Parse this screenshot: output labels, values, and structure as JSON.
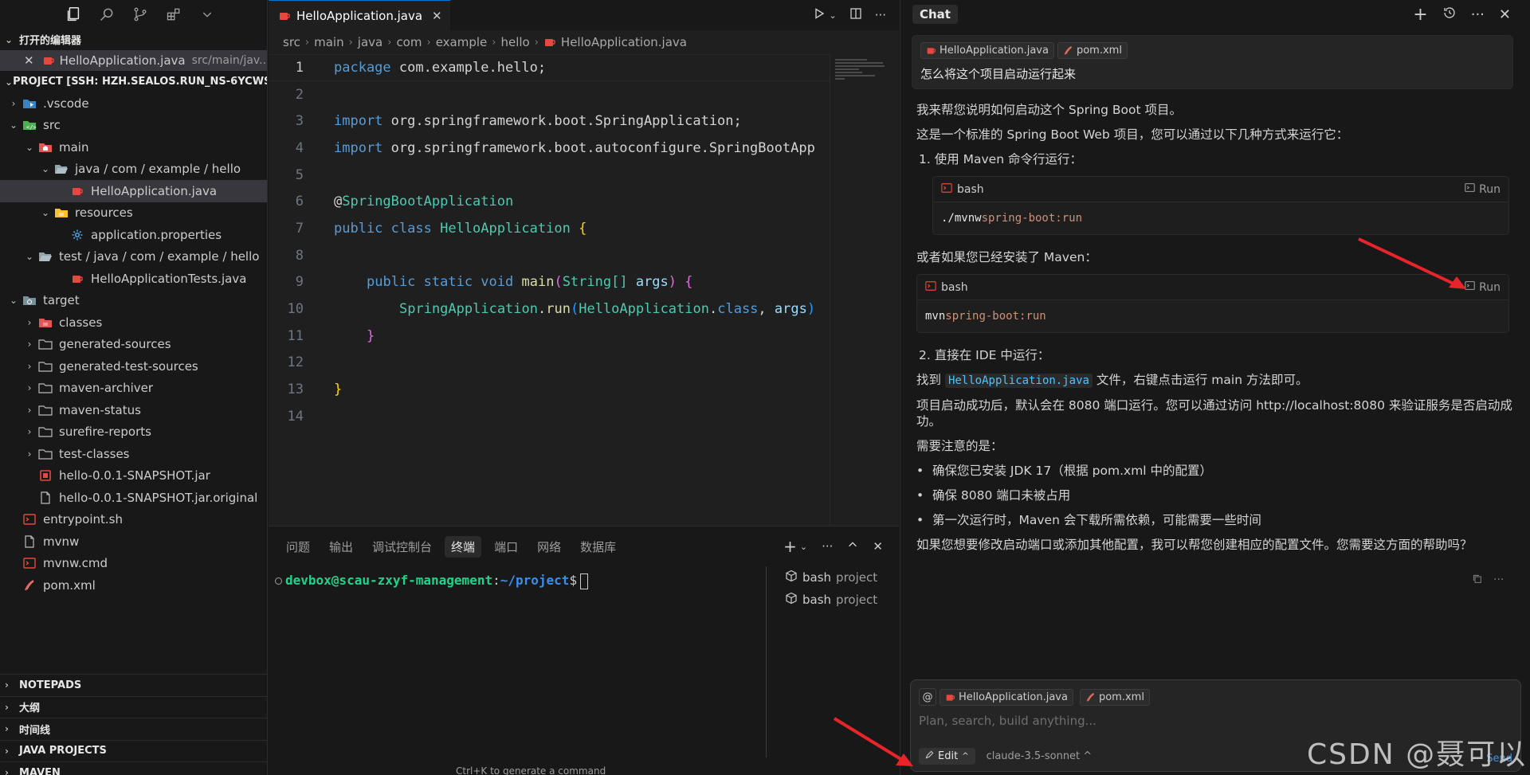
{
  "sidebar": {
    "open_editors_title": "打开的编辑器",
    "open_editor": {
      "name": "HelloApplication.java",
      "path": "src/main/jav..."
    },
    "project_title": "PROJECT [SSH: HZH.SEALOS.RUN_NS-6YCWS...",
    "tree": [
      {
        "label": ".vscode",
        "depth": 1,
        "chev": "›",
        "icon": "vscode-folder-icon"
      },
      {
        "label": "src",
        "depth": 1,
        "chev": "⌄",
        "icon": "src-folder-icon"
      },
      {
        "label": "main",
        "depth": 2,
        "chev": "⌄",
        "icon": "main-folder-icon"
      },
      {
        "label": "java / com / example / hello",
        "depth": 3,
        "chev": "⌄",
        "icon": "folder-open-icon"
      },
      {
        "label": "HelloApplication.java",
        "depth": 4,
        "chev": "",
        "icon": "java-file-icon",
        "selected": true
      },
      {
        "label": "resources",
        "depth": 3,
        "chev": "⌄",
        "icon": "resources-folder-icon"
      },
      {
        "label": "application.properties",
        "depth": 4,
        "chev": "",
        "icon": "gear-file-icon"
      },
      {
        "label": "test / java / com / example / hello",
        "depth": 2,
        "chev": "⌄",
        "icon": "folder-open-icon"
      },
      {
        "label": "HelloApplicationTests.java",
        "depth": 4,
        "chev": "",
        "icon": "java-file-icon"
      },
      {
        "label": "target",
        "depth": 1,
        "chev": "⌄",
        "icon": "target-folder-icon"
      },
      {
        "label": "classes",
        "depth": 2,
        "chev": "›",
        "icon": "classes-folder-icon"
      },
      {
        "label": "generated-sources",
        "depth": 2,
        "chev": "›",
        "icon": "folder-icon"
      },
      {
        "label": "generated-test-sources",
        "depth": 2,
        "chev": "›",
        "icon": "folder-icon"
      },
      {
        "label": "maven-archiver",
        "depth": 2,
        "chev": "›",
        "icon": "folder-icon"
      },
      {
        "label": "maven-status",
        "depth": 2,
        "chev": "›",
        "icon": "folder-icon"
      },
      {
        "label": "surefire-reports",
        "depth": 2,
        "chev": "›",
        "icon": "folder-icon"
      },
      {
        "label": "test-classes",
        "depth": 2,
        "chev": "›",
        "icon": "folder-icon"
      },
      {
        "label": "hello-0.0.1-SNAPSHOT.jar",
        "depth": 2,
        "chev": "",
        "icon": "jar-file-icon"
      },
      {
        "label": "hello-0.0.1-SNAPSHOT.jar.original",
        "depth": 2,
        "chev": "",
        "icon": "file-icon"
      },
      {
        "label": "entrypoint.sh",
        "depth": 1,
        "chev": "",
        "icon": "shell-file-icon"
      },
      {
        "label": "mvnw",
        "depth": 1,
        "chev": "",
        "icon": "file-icon"
      },
      {
        "label": "mvnw.cmd",
        "depth": 1,
        "chev": "",
        "icon": "shell-file-icon"
      },
      {
        "label": "pom.xml",
        "depth": 1,
        "chev": "",
        "icon": "maven-file-icon"
      }
    ],
    "bottom_sections": [
      "NOTEPADS",
      "大纲",
      "时间线",
      "JAVA PROJECTS",
      "MAVEN"
    ]
  },
  "editor": {
    "tab_label": "HelloApplication.java",
    "breadcrumb": [
      "src",
      "main",
      "java",
      "com",
      "example",
      "hello",
      "HelloApplication.java"
    ],
    "line_numbers": [
      "1",
      "2",
      "3",
      "4",
      "5",
      "6",
      "7",
      "8",
      "9",
      "10",
      "11",
      "12",
      "13",
      "14"
    ],
    "code": {
      "l1_kw": "package",
      "l1_rest": " com.example.hello;",
      "l3_kw": "import",
      "l3_rest": " org.springframework.boot.SpringApplication;",
      "l4_kw": "import",
      "l4_rest": " org.springframework.boot.autoconfigure.SpringBootApp",
      "l6_at": "@",
      "l6_annot": "SpringBootApplication",
      "l7_kw": "public class",
      "l7_cls": "HelloApplication",
      "l7_brace": "{",
      "l9_kw": "public static void",
      "l9_fn": "main",
      "l9_p1": "(",
      "l9_type": "String[]",
      "l9_var": "args",
      "l9_p2": ")",
      "l9_brace": "{",
      "l10_cls": "SpringApplication",
      "l10_dot": ".",
      "l10_fn": "run",
      "l10_p1": "(",
      "l10_cls2": "HelloApplication",
      "l10_dot2": ".",
      "l10_kw": "class",
      "l10_comma": ", ",
      "l10_var": "args",
      "l10_p2": ")",
      "l11_brace": "}",
      "l13_brace": "}"
    }
  },
  "panel": {
    "tabs": [
      "问题",
      "输出",
      "调试控制台",
      "终端",
      "端口",
      "网络",
      "数据库"
    ],
    "active_tab": 3,
    "prompt_user": "devbox@scau-zxyf-management",
    "prompt_sep": ":",
    "prompt_path": "~/project",
    "prompt_dollar": "$",
    "terminals": [
      {
        "name": "bash",
        "sub": "project"
      },
      {
        "name": "bash",
        "sub": "project"
      }
    ],
    "hint": "Ctrl+K to generate a command"
  },
  "chat": {
    "title": "Chat",
    "user_context": [
      "HelloApplication.java",
      "pom.xml"
    ],
    "user_message": "怎么将这个项目启动运行起来",
    "intro1": "我来帮您说明如何启动这个 Spring Boot 项目。",
    "intro2": "这是一个标准的 Spring Boot Web 项目，您可以通过以下几种方式来运行它：",
    "step1": "1. 使用 Maven 命令行运行：",
    "block1": {
      "lang": "bash",
      "run": "Run",
      "cmd": "./mvnw",
      "arg": " spring-boot:run"
    },
    "or_maven": "或者如果您已经安装了 Maven：",
    "block2": {
      "lang": "bash",
      "run": "Run",
      "cmd": "mvn",
      "arg": " spring-boot:run"
    },
    "step2": "2. 直接在 IDE 中运行：",
    "find_pre": "找到 ",
    "find_code": "HelloApplication.java",
    "find_post": " 文件，右键点击运行 main 方法即可。",
    "after_start": "项目启动成功后，默认会在 8080 端口运行。您可以通过访问 http://localhost:8080 来验证服务是否启动成功。",
    "notes_title": "需要注意的是：",
    "notes": [
      "确保您已安装 JDK 17（根据 pom.xml 中的配置）",
      "确保 8080 端口未被占用",
      "第一次运行时，Maven 会下载所需依赖，可能需要一些时间"
    ],
    "closing": "如果您想要修改启动端口或添加其他配置，我可以帮您创建相应的配置文件。您需要这方面的帮助吗？",
    "composer": {
      "at": "@",
      "context": [
        "HelloApplication.java",
        "pom.xml"
      ],
      "placeholder": "Plan, search, build anything...",
      "mode": "Edit",
      "model": "claude-3.5-sonnet ^",
      "send": "Send"
    }
  },
  "watermark": "CSDN @聂可以",
  "colors": {
    "accent": "#0078d4",
    "java": "#e5483e",
    "arrow": "#e8242b"
  }
}
